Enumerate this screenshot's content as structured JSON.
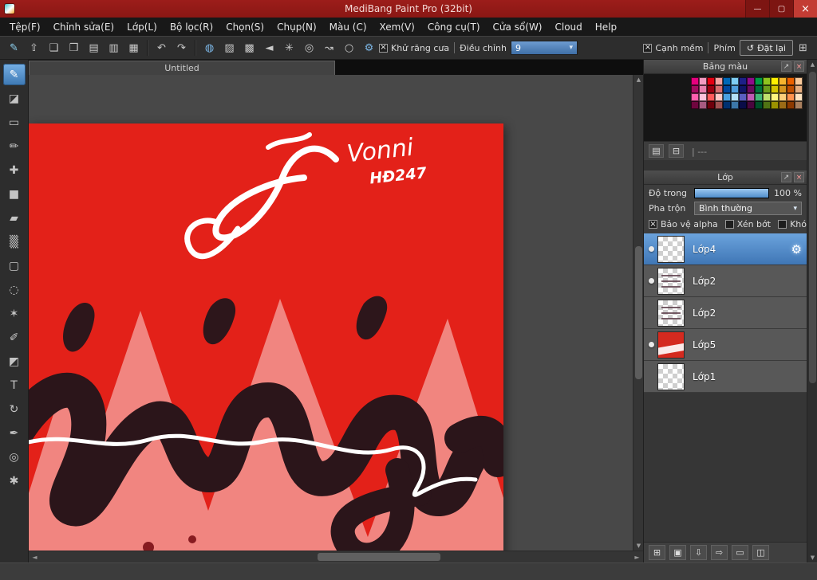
{
  "window": {
    "title": "MediBang Paint Pro (32bit)",
    "controls": [
      {
        "name": "minimize-button",
        "glyph": "—",
        "accent": false
      },
      {
        "name": "maximize-button",
        "glyph": "▢",
        "accent": false
      },
      {
        "name": "close-button",
        "glyph": "×",
        "accent": true
      }
    ]
  },
  "menu": {
    "items": [
      "Tệp(F)",
      "Chỉnh sửa(E)",
      "Lớp(L)",
      "Bộ lọc(R)",
      "Chọn(S)",
      "Chụp(N)",
      "Màu (C)",
      "Xem(V)",
      "Công cụ(T)",
      "Cửa sổ(W)",
      "Cloud",
      "Help"
    ]
  },
  "toolbar": {
    "file_icons": [
      {
        "name": "pen-settings-button",
        "glyph": "✎",
        "color": "#8fd3f2"
      },
      {
        "name": "export-button",
        "glyph": "⇧"
      },
      {
        "name": "comment-button",
        "glyph": "❑"
      },
      {
        "name": "panel-button",
        "glyph": "❒"
      },
      {
        "name": "document-button",
        "glyph": "▤"
      },
      {
        "name": "document-list-button",
        "glyph": "▥"
      },
      {
        "name": "material-grid-button",
        "glyph": "▦"
      }
    ],
    "history_icons": [
      {
        "name": "undo-button",
        "glyph": "↶"
      },
      {
        "name": "redo-button",
        "glyph": "↷"
      }
    ],
    "snap_icons": [
      {
        "name": "snap-off-button",
        "glyph": "◍",
        "color": "#7db8e8"
      },
      {
        "name": "snap-parallel-button",
        "glyph": "▨"
      },
      {
        "name": "snap-grid-button",
        "glyph": "▩"
      },
      {
        "name": "snap-vanish-button",
        "glyph": "◄"
      },
      {
        "name": "snap-cross-button",
        "glyph": "✳"
      },
      {
        "name": "snap-radial-button",
        "glyph": "◎"
      },
      {
        "name": "snap-curve-button",
        "glyph": "↝"
      },
      {
        "name": "snap-ellipse-button",
        "glyph": "○"
      },
      {
        "name": "snap-settings-button",
        "glyph": "⚙",
        "color": "#7db8e8"
      }
    ],
    "antialias_label": "Khử răng cưa",
    "antialias_checked": true,
    "adjust_label": "Điều chỉnh",
    "adjust_value": "9",
    "soft_edge_label": "Cạnh mềm",
    "soft_edge_checked": true,
    "key_label": "Phím",
    "reset_icon": "↺",
    "reset_label": "Đặt lại",
    "overflow_glyph": "⊞"
  },
  "tools": [
    {
      "name": "brush-tool",
      "glyph": "✎",
      "selected": true
    },
    {
      "name": "eraser-tool",
      "glyph": "◪"
    },
    {
      "name": "shape-brush-tool",
      "glyph": "▭"
    },
    {
      "name": "dot-pen-tool",
      "glyph": "✏"
    },
    {
      "name": "move-tool",
      "glyph": "✚"
    },
    {
      "name": "fill-shape-tool",
      "glyph": "■"
    },
    {
      "name": "bucket-tool",
      "glyph": "▰"
    },
    {
      "name": "gradient-tool",
      "glyph": "▒"
    },
    {
      "name": "select-rect-tool",
      "glyph": "▢"
    },
    {
      "name": "lasso-tool",
      "glyph": "◌"
    },
    {
      "name": "magic-wand-tool",
      "glyph": "✶"
    },
    {
      "name": "select-pen-tool",
      "glyph": "✐"
    },
    {
      "name": "select-eraser-tool",
      "glyph": "◩"
    },
    {
      "name": "text-tool",
      "glyph": "T"
    },
    {
      "name": "rotate-view-tool",
      "glyph": "↻"
    },
    {
      "name": "pen-tool",
      "glyph": "✒"
    },
    {
      "name": "eyedropper-tool",
      "glyph": "◎"
    },
    {
      "name": "hand-tool",
      "glyph": "✱"
    }
  ],
  "canvas": {
    "tab_title": "Untitled"
  },
  "artwork": {
    "background": "#e32119",
    "signature_line1": "Vonni",
    "signature_line2": "HĐ247"
  },
  "color_panel": {
    "title": "Bảng màu",
    "popout_glyph": "↗",
    "close_glyph": "×",
    "status": "| ---",
    "footer_icons": [
      {
        "name": "add-color-button",
        "glyph": "▤"
      },
      {
        "name": "delete-color-button",
        "glyph": "⊟"
      }
    ],
    "swatches": [
      "#e6007e",
      "#f29bc1",
      "#e60012",
      "#f5a2a0",
      "#0068b7",
      "#7ecef4",
      "#1d2088",
      "#8f0b8a",
      "#009a44",
      "#8fc31f",
      "#fff100",
      "#f6b52e",
      "#eb6100",
      "#f9c99a",
      "#a50b60",
      "#e87fae",
      "#9e0010",
      "#d86e6e",
      "#00479d",
      "#4f9fdd",
      "#101566",
      "#6a0a5e",
      "#00703a",
      "#6c9c1c",
      "#d4c500",
      "#d6951e",
      "#c04f00",
      "#e6ad7f",
      "#ff5fae",
      "#ffc3dc",
      "#ff5a5a",
      "#ffc8c5",
      "#4aa0e2",
      "#b3e1f7",
      "#5a5fc0",
      "#c05ab4",
      "#43b878",
      "#bfe06e",
      "#fff57e",
      "#ffd07a",
      "#ff934e",
      "#ffe3c1",
      "#70063f",
      "#a85a80",
      "#6e000b",
      "#a05050",
      "#003070",
      "#3c77a8",
      "#0a0c48",
      "#4a063e",
      "#004f28",
      "#4f7414",
      "#9c9300",
      "#9c6b16",
      "#8c3900",
      "#a87f5e"
    ]
  },
  "layer_panel": {
    "title": "Lớp",
    "popout_glyph": "↗",
    "close_glyph": "×",
    "opacity_label": "Độ trong",
    "opacity_value": "100 %",
    "opacity_percent": 100,
    "blend_label": "Pha trộn",
    "blend_value": "Bình thường",
    "checkboxes": [
      {
        "label": "Bảo vệ alpha",
        "checked": true
      },
      {
        "label": "Xén bớt",
        "checked": false
      },
      {
        "label": "Khóa",
        "checked": false
      }
    ],
    "layers": [
      {
        "name": "Lớp4",
        "selected": true,
        "visible": true,
        "thumb": "thumb-plain"
      },
      {
        "name": "Lớp2",
        "selected": false,
        "visible": true,
        "thumb": "thumb-text"
      },
      {
        "name": "Lớp2",
        "selected": false,
        "visible": false,
        "thumb": "thumb-text"
      },
      {
        "name": "Lớp5",
        "selected": false,
        "visible": true,
        "thumb": "thumb-red"
      },
      {
        "name": "Lớp1",
        "selected": false,
        "visible": false,
        "thumb": "thumb-plain"
      }
    ],
    "gear_glyph": "⚙",
    "footer_icons": [
      {
        "name": "add-layer-button",
        "glyph": "⊞"
      },
      {
        "name": "duplicate-layer-button",
        "glyph": "▣"
      },
      {
        "name": "merge-down-button",
        "glyph": "⇩"
      },
      {
        "name": "transfer-layer-button",
        "glyph": "⇨"
      },
      {
        "name": "layer-folder-button",
        "glyph": "▭"
      },
      {
        "name": "merge-visible-button",
        "glyph": "◫"
      }
    ]
  }
}
